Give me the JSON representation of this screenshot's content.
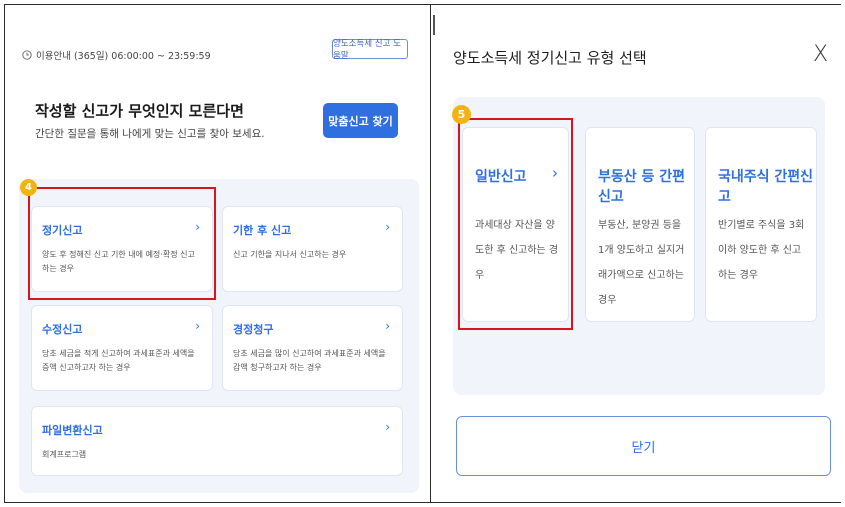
{
  "left": {
    "hours": "이용안내 (365일) 06:00:00 ~ 23:59:59",
    "help_button": "양도소득세 신고 도움말",
    "headline": "작성할 신고가 무엇인지 모른다면",
    "subline": "간단한 질문을 통해 나에게 맞는 신고를 찾아 보세요.",
    "find_button": "맞춤신고 찾기",
    "step_badge": "4",
    "cards": [
      {
        "title": "정기신고",
        "desc": "양도 후 정해진 신고 기한 내에 예정·확정 신고하는 경우"
      },
      {
        "title": "기한 후 신고",
        "desc": "신고 기한을 지나서 신고하는 경우"
      },
      {
        "title": "수정신고",
        "desc": "당초 세금을 적게 신고하여 과세표준과 세액을 증액 신고하고자 하는 경우"
      },
      {
        "title": "경정청구",
        "desc": "당초 세금을 많이 신고하여 과세표준과 세액을 감액 청구하고자 하는 경우"
      },
      {
        "title": "파일변환신고",
        "desc": "회계프로그램"
      }
    ],
    "chevron": "›"
  },
  "dialog": {
    "title": "양도소득세 정기신고 유형 선택",
    "close_glyph": "X",
    "step_badge": "5",
    "options": [
      {
        "title": "일반신고",
        "desc": "과세대상 자산을 양도한 후 신고하는 경우"
      },
      {
        "title": "부동산 등 간편신고",
        "desc": "부동산, 분양권 등을 1개 양도하고 실지거래가액으로 신고하는 경우"
      },
      {
        "title": "국내주식 간편신고",
        "desc": "반기별로 주식을 3회 이하 양도한 후 신고하는 경우"
      }
    ],
    "chevron": "›",
    "close_button": "닫기"
  },
  "colors": {
    "accent": "#2f6fe0",
    "highlight": "#d6161c",
    "badge": "#f2b315",
    "panel_bg": "#f1f5fb"
  }
}
